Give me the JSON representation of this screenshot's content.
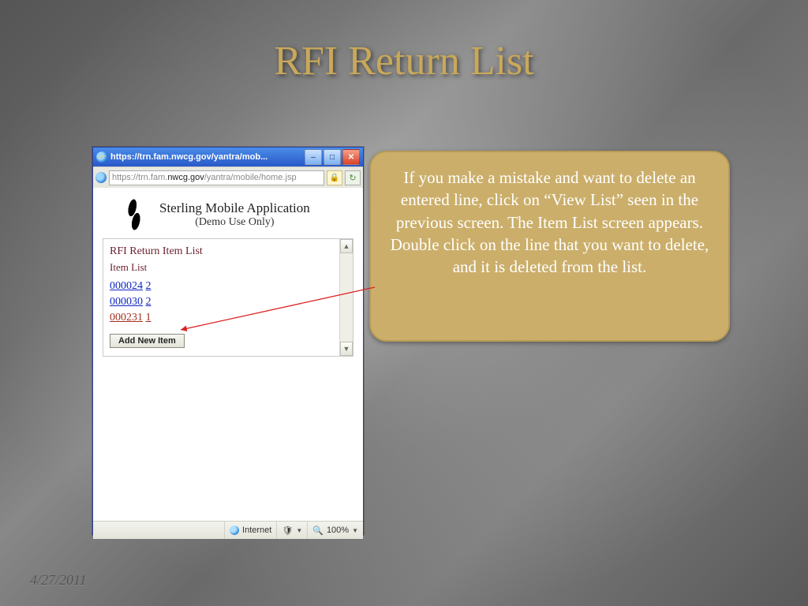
{
  "slide": {
    "title": "RFI Return List",
    "date": "4/27/2011"
  },
  "browser": {
    "window_title": "https://trn.fam.nwcg.gov/yantra/mob...",
    "url_gray_pre": "https://trn.fam.",
    "url_dark": "nwcg.gov",
    "url_gray_post": "/yantra/mobile/home.jsp"
  },
  "app": {
    "title": "Sterling Mobile Application",
    "subtitle": "(Demo Use Only)",
    "panel_title": "RFI Return Item List",
    "panel_sub": "Item List",
    "items": [
      {
        "id": "000024",
        "qty": "2",
        "hl": false
      },
      {
        "id": "000030",
        "qty": "2",
        "hl": false
      },
      {
        "id": "000231",
        "qty": "1",
        "hl": true
      }
    ],
    "add_btn": "Add New Item"
  },
  "status": {
    "zone": "Internet",
    "zoom": "100%"
  },
  "callout": {
    "text": "If you make a mistake and want to delete an entered line, click on “View List” seen in the previous screen. The Item List screen appears. Double click on the line that you want to delete, and it is deleted from the list."
  }
}
